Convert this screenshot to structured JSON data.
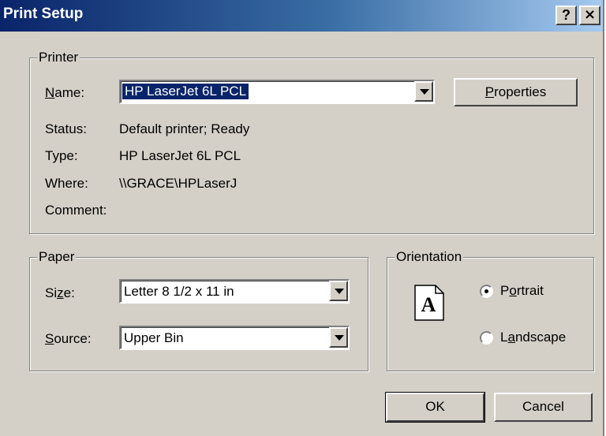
{
  "window": {
    "title": "Print Setup",
    "help_button": "?",
    "close_button": "×"
  },
  "printer": {
    "legend": "Printer",
    "name_label_u": "N",
    "name_label_rest": "ame:",
    "name_value": "HP LaserJet 6L PCL",
    "properties_u": "P",
    "properties_rest": "roperties",
    "status_label": "Status:",
    "status_value": "Default printer; Ready",
    "type_label": "Type:",
    "type_value": "HP LaserJet 6L PCL",
    "where_label": "Where:",
    "where_value": "\\\\GRACE\\HPLaserJ",
    "comment_label": "Comment:",
    "comment_value": ""
  },
  "paper": {
    "legend": "Paper",
    "size_label_pre": "Si",
    "size_label_u": "z",
    "size_label_post": "e:",
    "size_value": "Letter 8 1/2 x 11 in",
    "source_label_u": "S",
    "source_label_rest": "ource:",
    "source_value": "Upper Bin"
  },
  "orientation": {
    "legend": "Orientation",
    "icon_letter": "A",
    "portrait_pre": "P",
    "portrait_u": "o",
    "portrait_post": "rtrait",
    "portrait_selected": true,
    "landscape_pre": "L",
    "landscape_u": "a",
    "landscape_post": "ndscape",
    "landscape_selected": false
  },
  "buttons": {
    "ok": "OK",
    "cancel": "Cancel"
  }
}
